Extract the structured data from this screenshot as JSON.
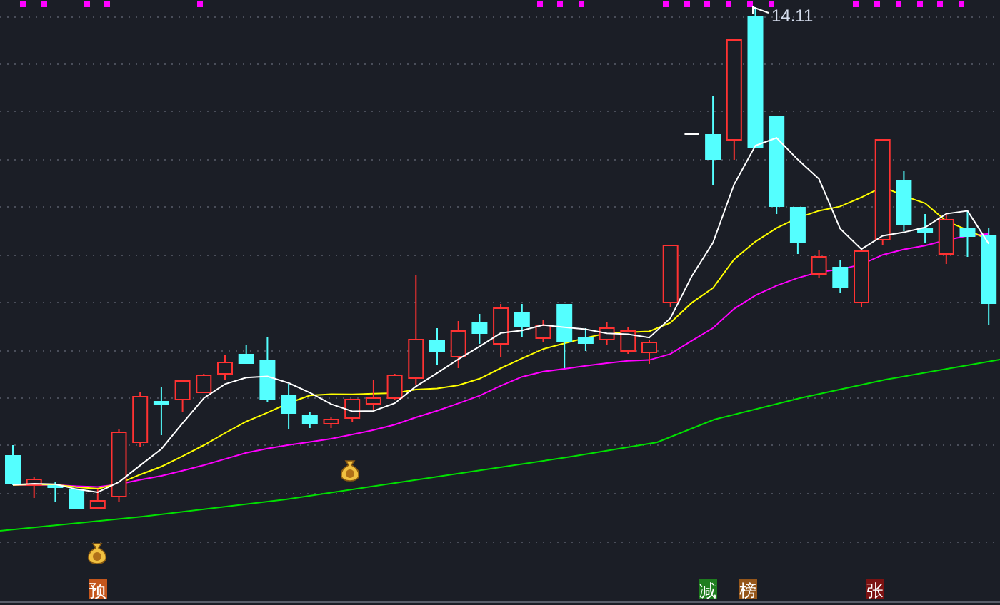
{
  "chart": {
    "high_label": "14.11",
    "markers": [
      {
        "text": "预",
        "color": "#c4561c"
      },
      {
        "text": "减",
        "color": "#1f7d1f"
      },
      {
        "text": "榜",
        "color": "#95561a"
      },
      {
        "text": "张",
        "color": "#7c1212"
      }
    ]
  }
}
